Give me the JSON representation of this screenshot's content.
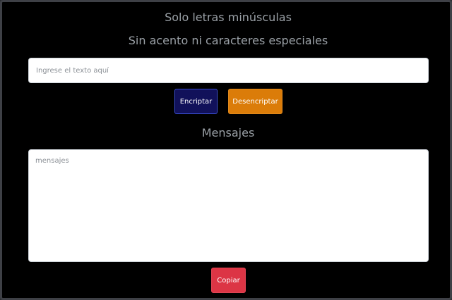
{
  "headings": {
    "rule_lowercase": "Solo letras minúsculas",
    "rule_no_accents": "Sin acento ni caracteres especiales",
    "messages_title": "Mensajes"
  },
  "input": {
    "value": "",
    "placeholder": "Ingrese el texto aquí"
  },
  "buttons": {
    "encrypt_label": "Encriptar",
    "decrypt_label": "Desencriptar",
    "copy_label": "Copiar"
  },
  "output": {
    "value": "",
    "placeholder": "mensajes"
  },
  "colors": {
    "background": "#000000",
    "encrypt_button": "#11115a",
    "decrypt_button": "#db7c09",
    "copy_button": "#dc3545",
    "heading_text": "#9aa0a6"
  }
}
